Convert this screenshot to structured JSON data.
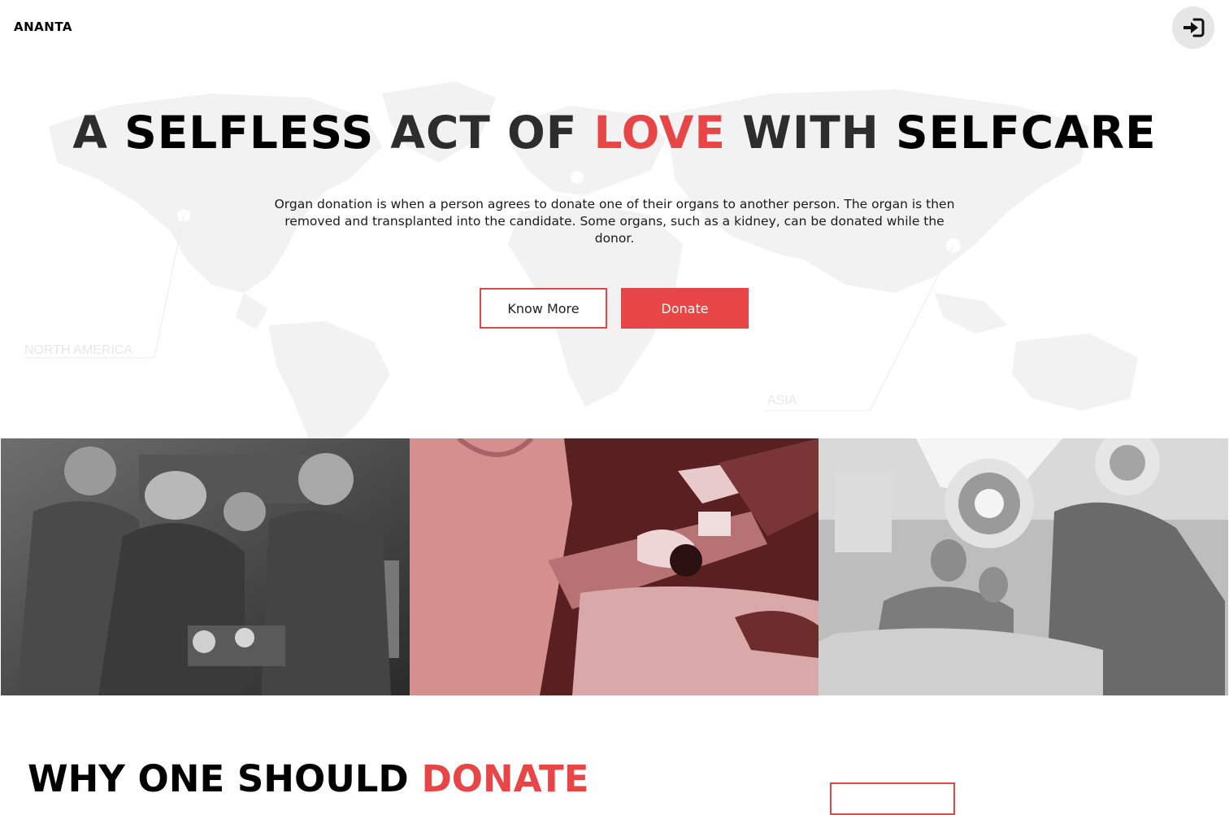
{
  "header": {
    "brand": "ANANTA",
    "login_icon": "sign-in-icon"
  },
  "background": {
    "map_label_north_america": "NORTH AMERICA",
    "map_label_asia": "ASIA"
  },
  "hero": {
    "title_parts": [
      "A",
      "SELFLESS",
      "ACT OF",
      "LOVE",
      "WITH",
      "SELFCARE"
    ],
    "description": "Organ donation is when a person agrees to donate one of their organs to another person. The organ is then removed and transplanted into the candidate. Some organs, such as a kidney, can be donated while the donor.",
    "know_more_label": "Know More",
    "donate_label": "Donate"
  },
  "photos": [
    {
      "name": "surgery-team-photo",
      "tint": "grayscale"
    },
    {
      "name": "blood-donation-photo",
      "tint": "red"
    },
    {
      "name": "operating-room-photo",
      "tint": "grayscale"
    }
  ],
  "why_section": {
    "title_black": "WHY ONE SHOULD",
    "title_red": "DONATE"
  },
  "colors": {
    "accent": "#e84646",
    "login_bg": "#e6e6e6",
    "map": "#f2f2f2"
  }
}
